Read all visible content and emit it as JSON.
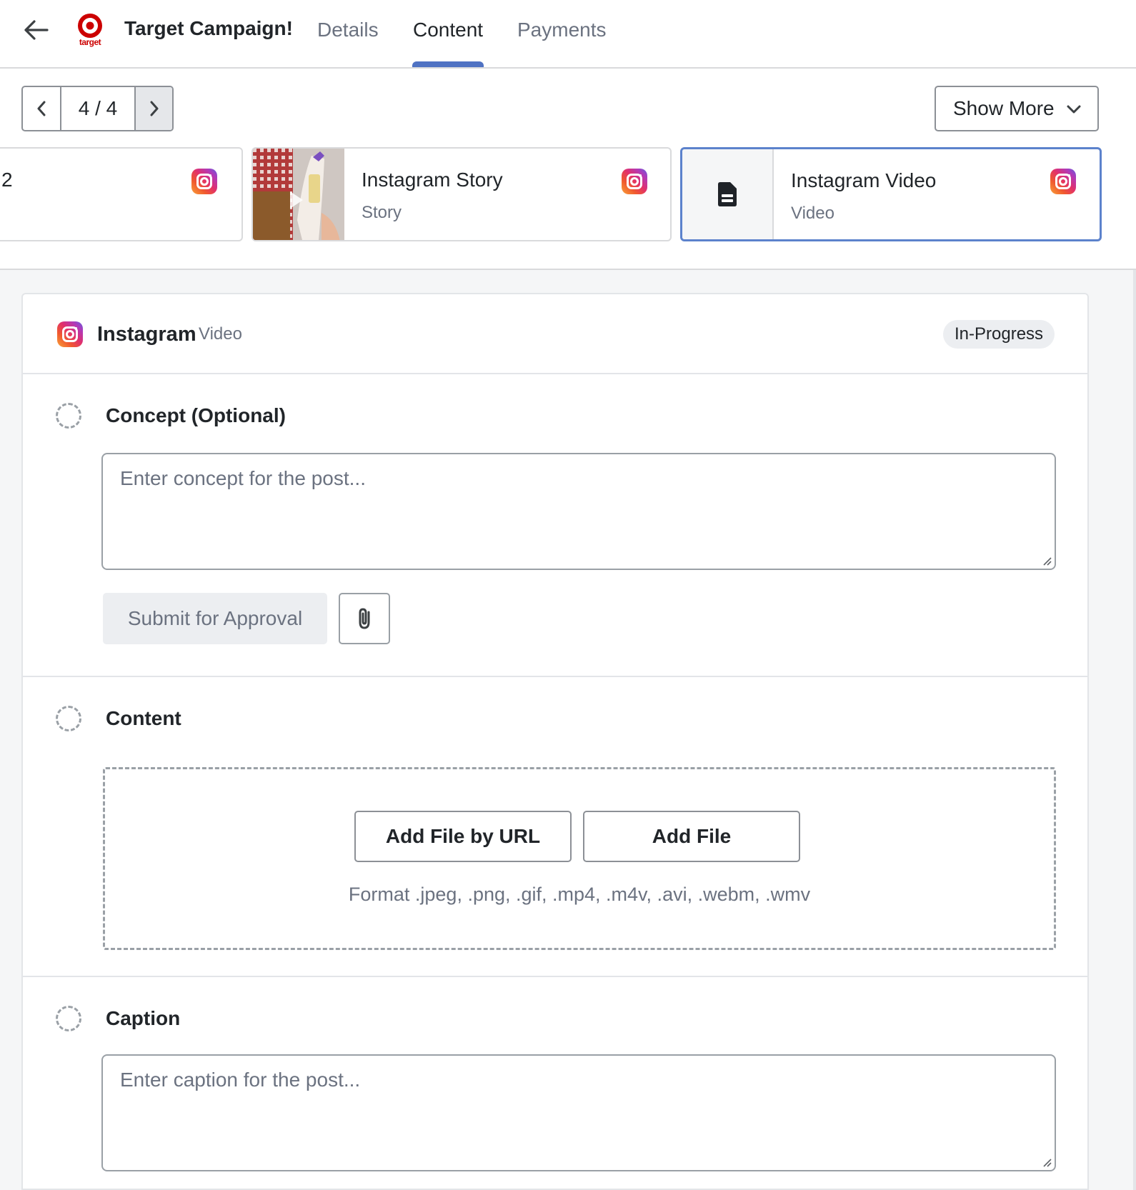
{
  "header": {
    "campaign_title": "Target Campaign!",
    "logo_text": "target",
    "tabs": [
      {
        "label": "Details"
      },
      {
        "label": "Content"
      },
      {
        "label": "Payments"
      }
    ],
    "active_tab": "Content"
  },
  "pager": {
    "count": "4 / 4"
  },
  "show_more": {
    "label": "Show More"
  },
  "deliverables": [
    {
      "number": "2",
      "title": "",
      "subtitle": "",
      "platform_icon": "instagram-icon"
    },
    {
      "title": "Instagram Story",
      "subtitle": "Story",
      "platform_icon": "instagram-icon",
      "thumbnail": "video-thumbnail"
    },
    {
      "title": "Instagram Video",
      "subtitle": "Video",
      "platform_icon": "instagram-icon",
      "thumbnail": "document-icon",
      "selected": true
    }
  ],
  "panel": {
    "platform": "Instagram",
    "type": "Video",
    "status": "In-Progress",
    "concept": {
      "title": "Concept (Optional)",
      "placeholder": "Enter concept for the post...",
      "submit_label": "Submit for Approval"
    },
    "content": {
      "title": "Content",
      "add_url_label": "Add File by URL",
      "add_file_label": "Add File",
      "formats": "Format .jpeg, .png, .gif, .mp4, .m4v, .avi, .webm, .wmv"
    },
    "caption": {
      "title": "Caption",
      "placeholder": "Enter caption for the post..."
    }
  },
  "colors": {
    "accent": "#4f72c3",
    "selected_border": "#5c82cc",
    "brand_red": "#cc0000"
  }
}
